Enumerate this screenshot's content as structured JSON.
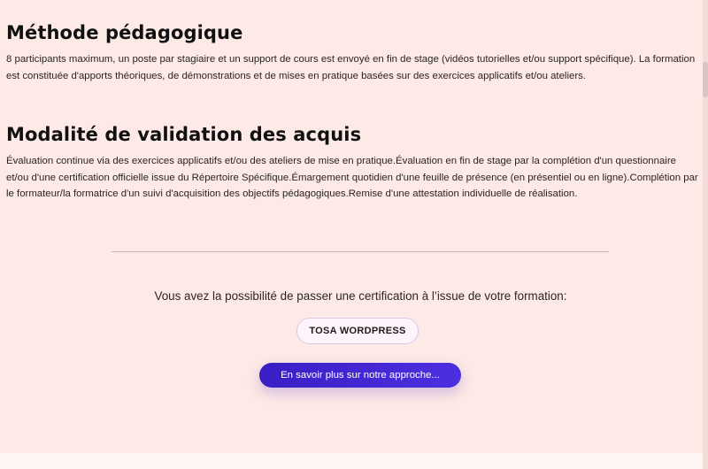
{
  "sections": {
    "method": {
      "title": "Méthode pédagogique",
      "text": "8 participants maximum, un poste par stagiaire et un support de cours est envoyé en fin de stage (vidéos tutorielles et/ou support spécifique). La formation est constituée d'apports théoriques, de démonstrations et de mises en pratique basées sur des exercices applicatifs et/ou ateliers."
    },
    "validation": {
      "title": "Modalité de validation des acquis",
      "text": "Évaluation continue via des exercices applicatifs et/ou des ateliers de mise en pratique.Évaluation en fin de stage par la complétion d'un questionnaire et/ou d'une certification officielle issue du Répertoire Spécifique.Émargement quotidien d'une feuille de présence (en présentiel ou en ligne).Complétion par le formateur/la formatrice d'un suivi d'acquisition des objectifs pédagogiques.Remise d'une attestation individuelle de réalisation."
    }
  },
  "certification": {
    "intro": "Vous avez la possibilité de passer une certification à l’issue de votre formation:",
    "badge": "TOSA WORDPRESS"
  },
  "cta": {
    "label": "En savoir plus sur notre approche..."
  },
  "colors": {
    "background": "#fde9e5",
    "cta_start": "#3a1ec4",
    "cta_end": "#4d2fe0"
  }
}
